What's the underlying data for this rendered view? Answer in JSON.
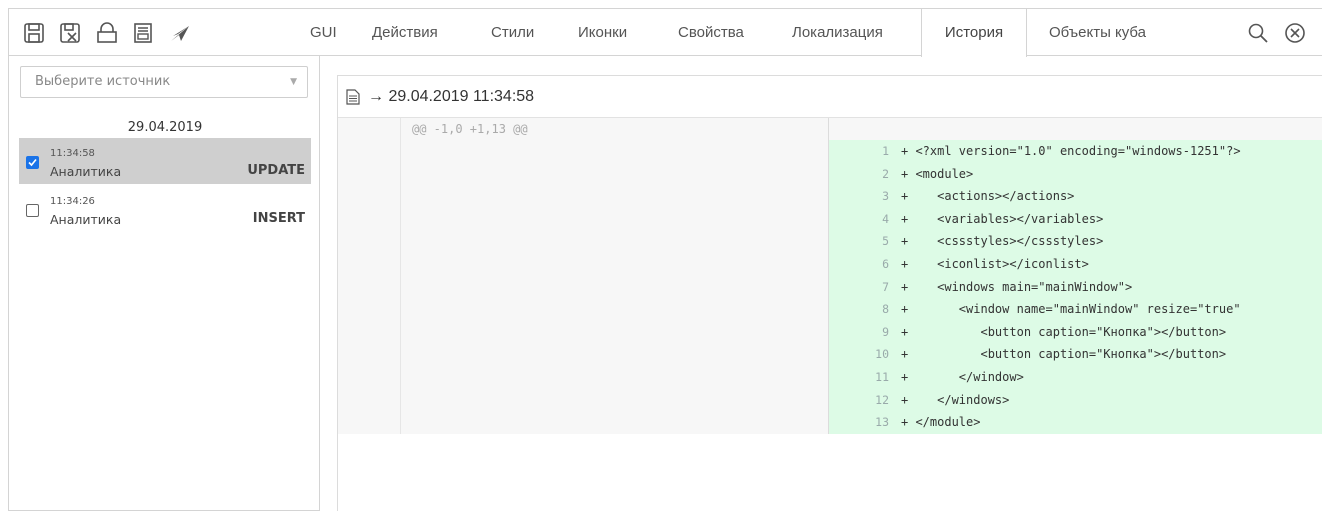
{
  "toolbar": {
    "icons": [
      "save-icon",
      "save-as-icon",
      "lock-icon",
      "report-icon",
      "send-icon"
    ],
    "tabs": [
      {
        "label": "GUI",
        "active": false
      },
      {
        "label": "Действия",
        "active": false
      },
      {
        "label": "Стили",
        "active": false
      },
      {
        "label": "Иконки",
        "active": false
      },
      {
        "label": "Свойства",
        "active": false
      },
      {
        "label": "Локализация",
        "active": false
      },
      {
        "label": "История",
        "active": true
      },
      {
        "label": "Объекты куба",
        "active": false
      }
    ],
    "actions": [
      "search-icon",
      "close-icon"
    ]
  },
  "history": {
    "source_placeholder": "Выберите источник",
    "date": "29.04.2019",
    "items": [
      {
        "time": "11:34:58",
        "name": "Аналитика",
        "action": "UPDATE",
        "checked": true
      },
      {
        "time": "11:34:26",
        "name": "Аналитика",
        "action": "INSERT",
        "checked": false
      }
    ]
  },
  "diff": {
    "title": "→ 29.04.2019 11:34:58",
    "hunk": "@@ -1,0 +1,13 @@",
    "lines": [
      {
        "n": "1",
        "code": "+ <?xml version=\"1.0\" encoding=\"windows-1251\"?>"
      },
      {
        "n": "2",
        "code": "+ <module>"
      },
      {
        "n": "3",
        "code": "+    <actions></actions>"
      },
      {
        "n": "4",
        "code": "+    <variables></variables>"
      },
      {
        "n": "5",
        "code": "+    <cssstyles></cssstyles>"
      },
      {
        "n": "6",
        "code": "+    <iconlist></iconlist>"
      },
      {
        "n": "7",
        "code": "+    <windows main=\"mainWindow\">"
      },
      {
        "n": "8",
        "code": "+       <window name=\"mainWindow\" resize=\"true\""
      },
      {
        "n": "9",
        "code": "+          <button caption=\"Кнопка\"></button>"
      },
      {
        "n": "10",
        "code": "+          <button caption=\"Кнопка\"></button>"
      },
      {
        "n": "11",
        "code": "+       </window>"
      },
      {
        "n": "12",
        "code": "+    </windows>"
      },
      {
        "n": "13",
        "code": "+ </module>"
      }
    ]
  },
  "colors": {
    "added_bg": "#ddfbe6",
    "selected_bg": "#cfcfcf",
    "checkbox": "#1a73e8"
  }
}
